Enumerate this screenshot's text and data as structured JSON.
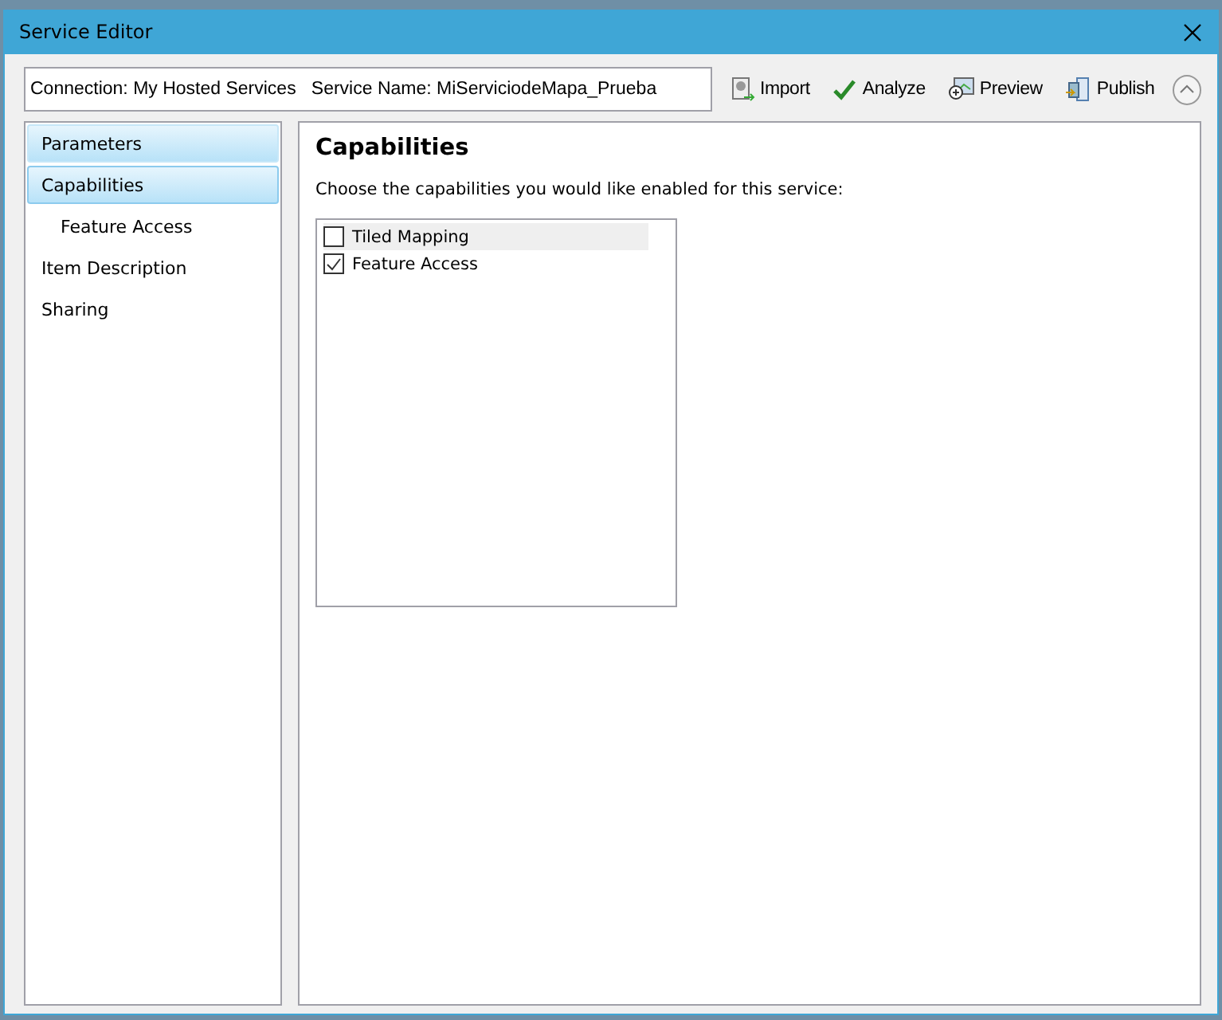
{
  "window": {
    "title": "Service Editor"
  },
  "connection_field": {
    "value": "Connection: My Hosted Services   Service Name: MiServiciodeMapa_Prueba"
  },
  "toolbar": [
    {
      "label": "Import",
      "kind": "import"
    },
    {
      "label": "Analyze",
      "kind": "analyze"
    },
    {
      "label": "Preview",
      "kind": "preview"
    },
    {
      "label": "Publish",
      "kind": "publish"
    }
  ],
  "sidebar": {
    "items": [
      {
        "label": "Parameters",
        "selected": false,
        "highlighted": true
      },
      {
        "label": "Capabilities",
        "selected": true,
        "highlighted": true,
        "children": [
          {
            "label": "Feature Access",
            "selected": false,
            "highlighted": false
          }
        ]
      },
      {
        "label": "Item Description",
        "selected": false,
        "highlighted": false
      },
      {
        "label": "Sharing",
        "selected": false,
        "highlighted": false
      }
    ]
  },
  "content": {
    "heading": "Capabilities",
    "description": "Choose the capabilities you would like enabled for this service:",
    "capabilities": [
      {
        "label": "Tiled Mapping",
        "checked": false,
        "highlighted": true
      },
      {
        "label": "Feature Access",
        "checked": true,
        "highlighted": false
      }
    ]
  }
}
